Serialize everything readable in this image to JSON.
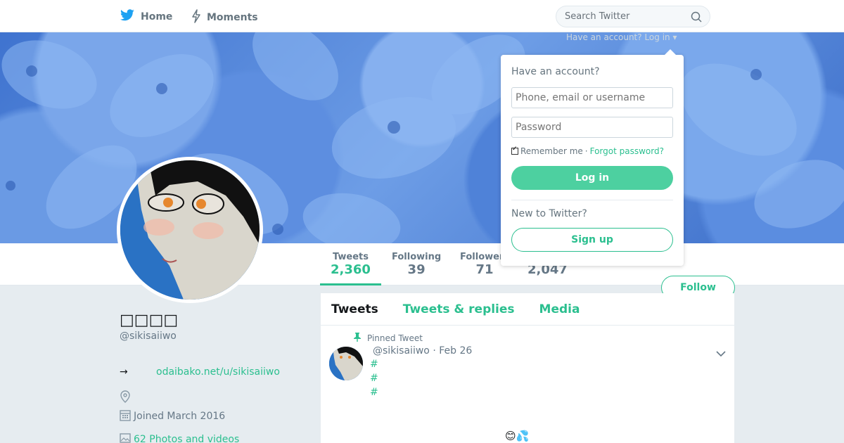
{
  "nav": {
    "home_label": "Home",
    "moments_label": "Moments",
    "search_placeholder": "Search Twitter"
  },
  "login_hint": "Have an account? Log in ▾",
  "login": {
    "heading": "Have an account?",
    "username_placeholder": "Phone, email or username",
    "password_placeholder": "Password",
    "remember_label": "Remember me",
    "separator": "·",
    "forgot_label": "Forgot password?",
    "login_button": "Log in",
    "new_heading": "New to Twitter?",
    "signup_button": "Sign up"
  },
  "stats": {
    "tweets_label": "Tweets",
    "tweets_value": "2,360",
    "following_label": "Following",
    "following_value": "39",
    "followers_label": "Followers",
    "followers_value": "71",
    "likes_value": "2,047"
  },
  "follow_button": "Follow",
  "profile": {
    "name": "□□□□",
    "handle": "@sikisaiiwo",
    "link_arrow": "→",
    "link": "odaibako.net/u/sikisaiiwo",
    "joined": "Joined March 2016",
    "photos": "62 Photos and videos"
  },
  "timeline": {
    "tabs": [
      "Tweets",
      "Tweets & replies",
      "Media"
    ],
    "pinned_label": "Pinned Tweet",
    "tweet_handle": "@sikisaiiwo",
    "tweet_sep": "·",
    "tweet_date": "Feb 26",
    "hashtags": [
      "#",
      "#",
      "#"
    ],
    "emoji": "😊💦"
  },
  "colors": {
    "accent": "#2bbf8f",
    "login_button_bg": "#4dd0a0",
    "background": "#e6ecf0"
  },
  "icons": {
    "home": "twitter-bird-icon",
    "moments": "lightning-icon",
    "search": "search-icon",
    "pin": "pin-icon",
    "location": "location-icon",
    "calendar": "calendar-icon",
    "photo": "photo-icon",
    "caret": "chevron-down-icon"
  }
}
